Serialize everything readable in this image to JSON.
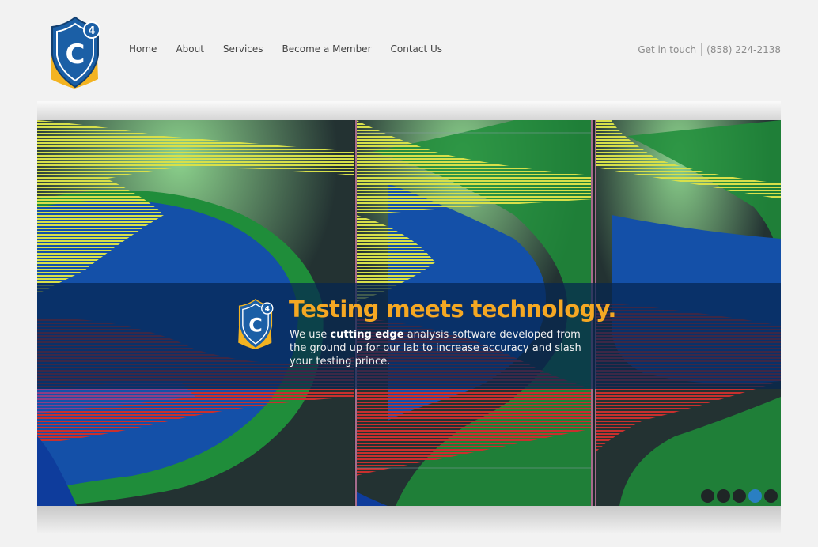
{
  "brand": {
    "logo_alt": "C4",
    "logo_letter": "C",
    "logo_sup": "4",
    "colors": {
      "shield": "#1b5fa6",
      "ribbon": "#f3b321",
      "headline": "#f5a823"
    }
  },
  "nav": [
    {
      "label": "Home"
    },
    {
      "label": "About"
    },
    {
      "label": "Services"
    },
    {
      "label": "Become a Member"
    },
    {
      "label": "Contact Us"
    }
  ],
  "contact": {
    "label": "Get in touch",
    "phone": "(858) 224-2138"
  },
  "hero": {
    "headline": "Testing meets technology.",
    "body_pre": "We use ",
    "body_bold": "cutting edge",
    "body_post": " analysis software developed from the ground up for our lab to increase accuracy and slash your testing prince.",
    "slide_count": 5,
    "active_slide": 4
  }
}
